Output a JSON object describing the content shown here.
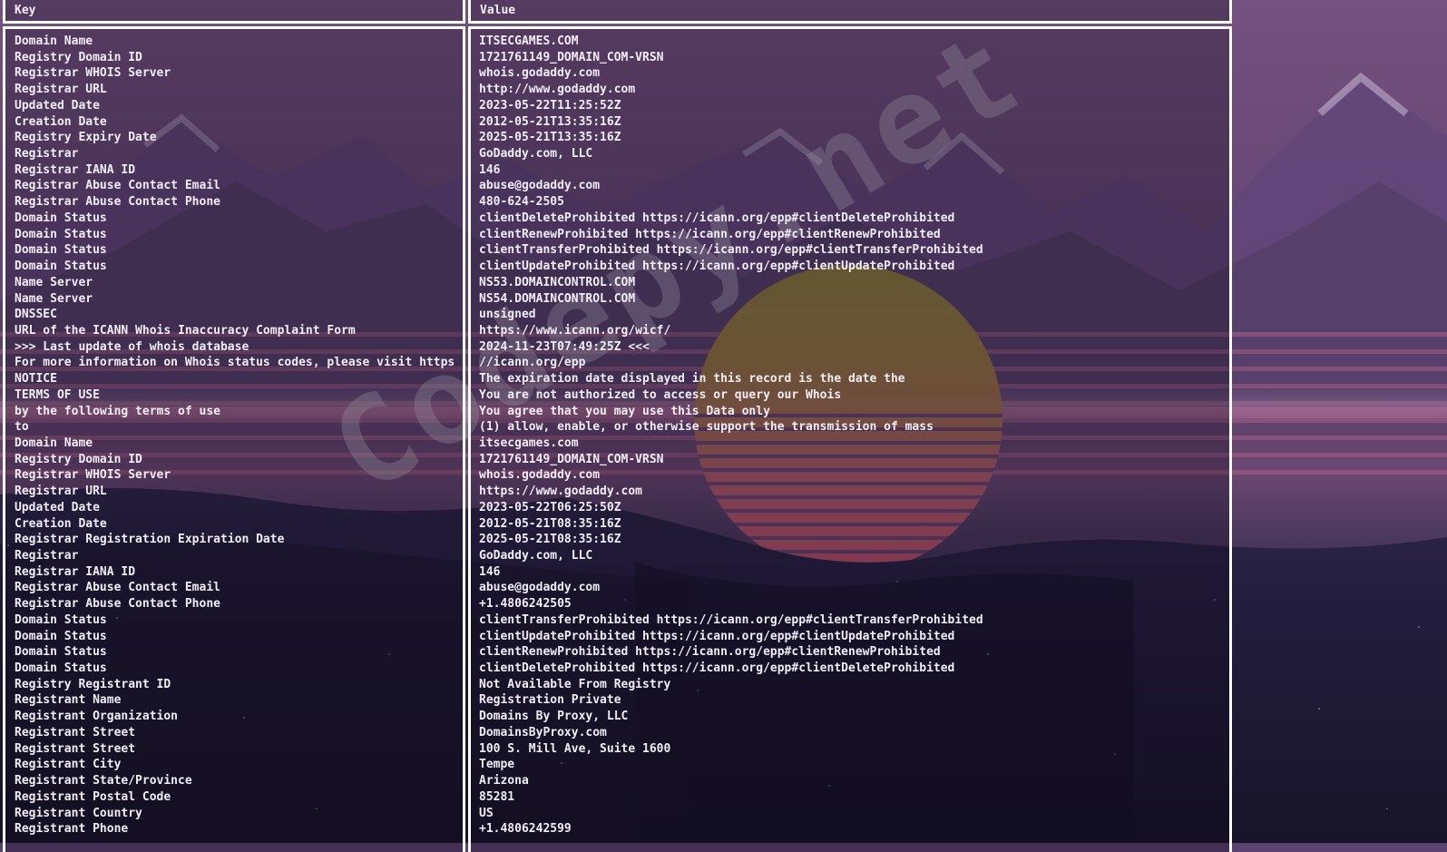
{
  "watermark": {
    "text": "Codepy.net"
  },
  "colors": {
    "border": "#ffffff",
    "text": "#f2edf5",
    "overlay": "rgba(14,7,24,0.30)",
    "sky_top": "#75527f",
    "sun_top": "#8a7a3e",
    "sun_bottom": "#b84f6a",
    "water": "#1d1930"
  },
  "table": {
    "columns": [
      "Key",
      "Value"
    ],
    "rows": [
      {
        "key": "Domain Name",
        "value": "ITSECGAMES.COM"
      },
      {
        "key": "Registry Domain ID",
        "value": "1721761149_DOMAIN_COM-VRSN"
      },
      {
        "key": "Registrar WHOIS Server",
        "value": "whois.godaddy.com"
      },
      {
        "key": "Registrar URL",
        "value": "http://www.godaddy.com"
      },
      {
        "key": "Updated Date",
        "value": "2023-05-22T11:25:52Z"
      },
      {
        "key": "Creation Date",
        "value": "2012-05-21T13:35:16Z"
      },
      {
        "key": "Registry Expiry Date",
        "value": "2025-05-21T13:35:16Z"
      },
      {
        "key": "Registrar",
        "value": "GoDaddy.com, LLC"
      },
      {
        "key": "Registrar IANA ID",
        "value": "146"
      },
      {
        "key": "Registrar Abuse Contact Email",
        "value": "abuse@godaddy.com"
      },
      {
        "key": "Registrar Abuse Contact Phone",
        "value": "480-624-2505"
      },
      {
        "key": "Domain Status",
        "value": "clientDeleteProhibited https://icann.org/epp#clientDeleteProhibited"
      },
      {
        "key": "Domain Status",
        "value": "clientRenewProhibited https://icann.org/epp#clientRenewProhibited"
      },
      {
        "key": "Domain Status",
        "value": "clientTransferProhibited https://icann.org/epp#clientTransferProhibited"
      },
      {
        "key": "Domain Status",
        "value": "clientUpdateProhibited https://icann.org/epp#clientUpdateProhibited"
      },
      {
        "key": "Name Server",
        "value": "NS53.DOMAINCONTROL.COM"
      },
      {
        "key": "Name Server",
        "value": "NS54.DOMAINCONTROL.COM"
      },
      {
        "key": "DNSSEC",
        "value": "unsigned"
      },
      {
        "key": "URL of the ICANN Whois Inaccuracy Complaint Form",
        "value": "https://www.icann.org/wicf/"
      },
      {
        "key": ">>> Last update of whois database",
        "value": "2024-11-23T07:49:25Z <<<"
      },
      {
        "key": "For more information on Whois status codes, please visit https",
        "value": "//icann.org/epp"
      },
      {
        "key": "NOTICE",
        "value": "The expiration date displayed in this record is the date the"
      },
      {
        "key": "TERMS OF USE",
        "value": "You are not authorized to access or query our Whois"
      },
      {
        "key": "by the following terms of use",
        "value": "You agree that you may use this Data only"
      },
      {
        "key": "to",
        "value": "(1) allow, enable, or otherwise support the transmission of mass"
      },
      {
        "key": "Domain Name",
        "value": "itsecgames.com"
      },
      {
        "key": "Registry Domain ID",
        "value": "1721761149_DOMAIN_COM-VRSN"
      },
      {
        "key": "Registrar WHOIS Server",
        "value": "whois.godaddy.com"
      },
      {
        "key": "Registrar URL",
        "value": "https://www.godaddy.com"
      },
      {
        "key": "Updated Date",
        "value": "2023-05-22T06:25:50Z"
      },
      {
        "key": "Creation Date",
        "value": "2012-05-21T08:35:16Z"
      },
      {
        "key": "Registrar Registration Expiration Date",
        "value": "2025-05-21T08:35:16Z"
      },
      {
        "key": "Registrar",
        "value": "GoDaddy.com, LLC"
      },
      {
        "key": "Registrar IANA ID",
        "value": "146"
      },
      {
        "key": "Registrar Abuse Contact Email",
        "value": "abuse@godaddy.com"
      },
      {
        "key": "Registrar Abuse Contact Phone",
        "value": "+1.4806242505"
      },
      {
        "key": "Domain Status",
        "value": "clientTransferProhibited https://icann.org/epp#clientTransferProhibited"
      },
      {
        "key": "Domain Status",
        "value": "clientUpdateProhibited https://icann.org/epp#clientUpdateProhibited"
      },
      {
        "key": "Domain Status",
        "value": "clientRenewProhibited https://icann.org/epp#clientRenewProhibited"
      },
      {
        "key": "Domain Status",
        "value": "clientDeleteProhibited https://icann.org/epp#clientDeleteProhibited"
      },
      {
        "key": "Registry Registrant ID",
        "value": "Not Available From Registry"
      },
      {
        "key": "Registrant Name",
        "value": "Registration Private"
      },
      {
        "key": "Registrant Organization",
        "value": "Domains By Proxy, LLC"
      },
      {
        "key": "Registrant Street",
        "value": "DomainsByProxy.com"
      },
      {
        "key": "Registrant Street",
        "value": "100 S. Mill Ave, Suite 1600"
      },
      {
        "key": "Registrant City",
        "value": "Tempe"
      },
      {
        "key": "Registrant State/Province",
        "value": "Arizona"
      },
      {
        "key": "Registrant Postal Code",
        "value": "85281"
      },
      {
        "key": "Registrant Country",
        "value": "US"
      },
      {
        "key": "Registrant Phone",
        "value": "+1.4806242599"
      }
    ]
  }
}
